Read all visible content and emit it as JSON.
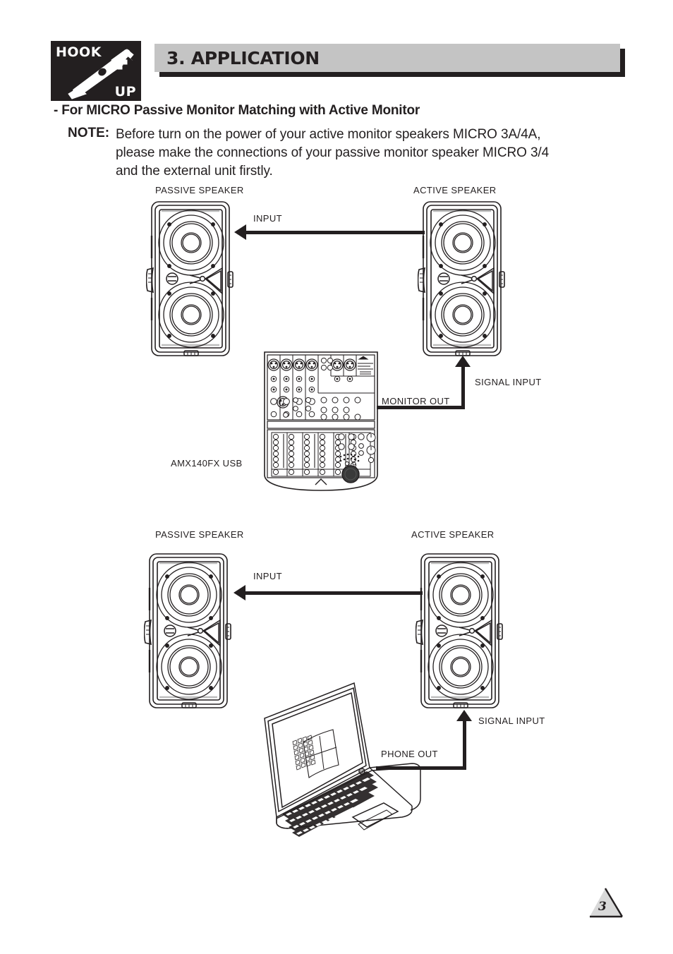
{
  "header": {
    "badge_line1": "HOOK",
    "badge_line2": "UP",
    "badge_icon": "plug-connector-icon",
    "title": "3. APPLICATION",
    "bar_color": "#c4c4c4",
    "shadow_color": "#231f20"
  },
  "intro": {
    "subtitle": "- For MICRO Passive Monitor Matching with Active Monitor",
    "note_label": "NOTE:",
    "note_line1": "Before turn on the power of your active monitor speakers MICRO 3A/4A,",
    "note_line2": "please make the connections of your passive monitor speaker MICRO 3/4",
    "note_line3": "and the external unit firstly."
  },
  "diagram1": {
    "passive_label": "PASSIVE SPEAKER",
    "active_label": "ACTIVE SPEAKER",
    "input_label": "INPUT",
    "monitor_out_label": "MONITOR OUT",
    "signal_input_label": "SIGNAL INPUT",
    "mixer_label": "AMX140FX USB",
    "mixer_icon": "audio-mixer-icon",
    "passive_speaker_icon": "studio-monitor-speaker-icon",
    "active_speaker_icon": "studio-monitor-speaker-icon"
  },
  "diagram2": {
    "passive_label": "PASSIVE SPEAKER",
    "active_label": "ACTIVE SPEAKER",
    "input_label": "INPUT",
    "phone_out_label": "PHONE OUT",
    "signal_input_label": "SIGNAL INPUT",
    "laptop_icon": "laptop-computer-icon",
    "screen_logo_icon": "windows-logo-icon",
    "passive_speaker_icon": "studio-monitor-speaker-icon",
    "active_speaker_icon": "studio-monitor-speaker-icon"
  },
  "footer": {
    "page_number": "3",
    "triangle_fill": "#d9d9d9"
  }
}
